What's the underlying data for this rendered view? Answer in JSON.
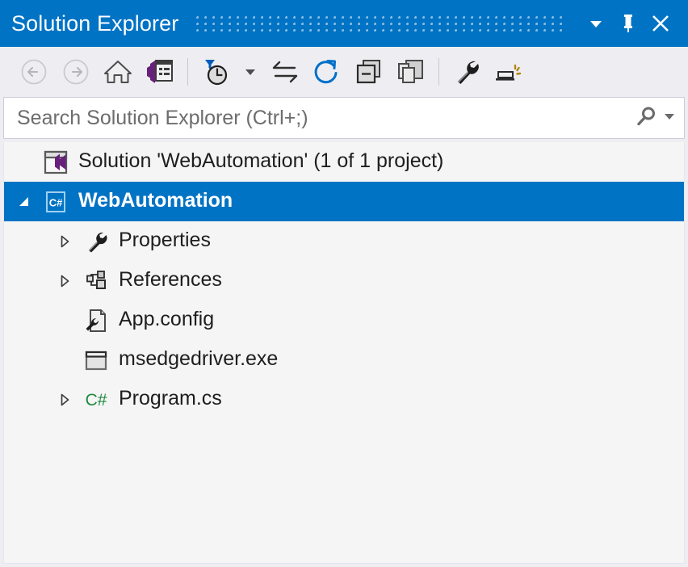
{
  "window": {
    "title": "Solution Explorer",
    "accent_color": "#0073C4",
    "toolbar_bg": "#EEEEF2",
    "tree_bg": "#F5F5F5",
    "buttons": [
      {
        "name": "window-menu-dropdown",
        "icon": "chevron-down-icon",
        "label": ""
      },
      {
        "name": "pin-window",
        "icon": "pin-icon",
        "label": ""
      },
      {
        "name": "close-window",
        "icon": "close-icon",
        "label": ""
      }
    ]
  },
  "toolbar": {
    "items": [
      {
        "name": "back",
        "icon": "back-arrow-icon",
        "label": "Back",
        "enabled": false
      },
      {
        "name": "forward",
        "icon": "forward-arrow-icon",
        "label": "Forward",
        "enabled": false
      },
      {
        "name": "home",
        "icon": "home-icon",
        "label": "Home",
        "enabled": true
      },
      {
        "name": "properties-window",
        "icon": "properties-window-icon",
        "label": "Properties Window",
        "enabled": true
      },
      {
        "name": "pending-changes-filter",
        "icon": "filter-clock-icon",
        "label": "Pending Changes Filter",
        "enabled": true
      },
      {
        "name": "filter-dropdown",
        "icon": "chevron-down-small-icon",
        "label": "",
        "enabled": true
      },
      {
        "name": "sync-with-active-document",
        "icon": "sync-arrows-icon",
        "label": "Sync with Active Document",
        "enabled": true
      },
      {
        "name": "refresh",
        "icon": "refresh-icon",
        "label": "Refresh",
        "enabled": true
      },
      {
        "name": "collapse-all",
        "icon": "collapse-all-icon",
        "label": "Collapse All",
        "enabled": true
      },
      {
        "name": "show-all-files",
        "icon": "show-all-files-icon",
        "label": "Show All Files",
        "enabled": true
      },
      {
        "name": "properties",
        "icon": "wrench-icon",
        "label": "Properties",
        "enabled": true
      },
      {
        "name": "preview-selected-items",
        "icon": "preview-selected-items-icon",
        "label": "Preview Selected Items",
        "enabled": true
      }
    ]
  },
  "search": {
    "placeholder": "Search Solution Explorer (Ctrl+;)",
    "value": "",
    "icon": "search-icon",
    "dropdown_icon": "chevron-down-small-icon"
  },
  "tree": {
    "nodes": [
      {
        "name": "solution-node",
        "label": "Solution 'WebAutomation' (1 of 1 project)",
        "icon": "solution-icon",
        "indent": 0,
        "twisty": "none",
        "selected": false
      },
      {
        "name": "project-webautomation",
        "label": "WebAutomation",
        "icon": "csharp-project-icon",
        "indent": 1,
        "twisty": "expanded",
        "selected": true
      },
      {
        "name": "folder-properties",
        "label": "Properties",
        "icon": "wrench-icon",
        "indent": 2,
        "twisty": "collapsed",
        "selected": false
      },
      {
        "name": "folder-references",
        "label": "References",
        "icon": "references-icon",
        "indent": 2,
        "twisty": "collapsed",
        "selected": false
      },
      {
        "name": "file-app-config",
        "label": "App.config",
        "icon": "config-file-icon",
        "indent": 2,
        "twisty": "none",
        "selected": false
      },
      {
        "name": "file-msedgedriver-exe",
        "label": "msedgedriver.exe",
        "icon": "application-icon",
        "indent": 2,
        "twisty": "none",
        "selected": false
      },
      {
        "name": "file-program-cs",
        "label": "Program.cs",
        "icon": "csharp-file-icon",
        "indent": 2,
        "twisty": "collapsed",
        "selected": false
      }
    ]
  }
}
